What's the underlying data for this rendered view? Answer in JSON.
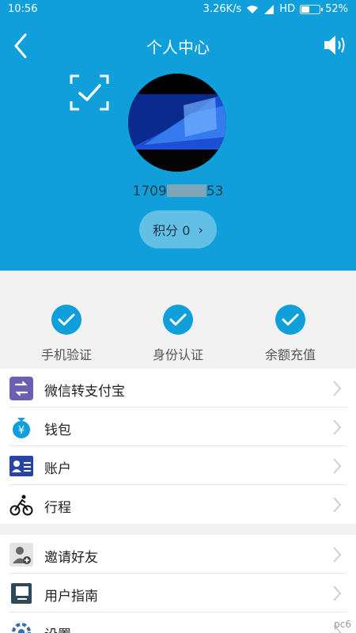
{
  "status_bar": {
    "time": "10:56",
    "speed": "3.26K/s",
    "network": "HD",
    "battery": "52%",
    "battery_level": 0.52
  },
  "nav": {
    "title": "个人中心"
  },
  "profile": {
    "phone_prefix": "1709",
    "phone_suffix": "53",
    "points_label": "积分 0",
    "points_arrow": "›"
  },
  "verifications": [
    {
      "label": "手机验证"
    },
    {
      "label": "身份认证"
    },
    {
      "label": "余额充值"
    }
  ],
  "menu_group1": [
    {
      "label": "微信转支付宝"
    },
    {
      "label": "钱包"
    },
    {
      "label": "账户"
    },
    {
      "label": "行程"
    }
  ],
  "menu_group2": [
    {
      "label": "邀请好友"
    },
    {
      "label": "用户指南"
    },
    {
      "label": "设置"
    }
  ],
  "watermark": "pc6",
  "colors": {
    "primary": "#0f9fdb"
  }
}
